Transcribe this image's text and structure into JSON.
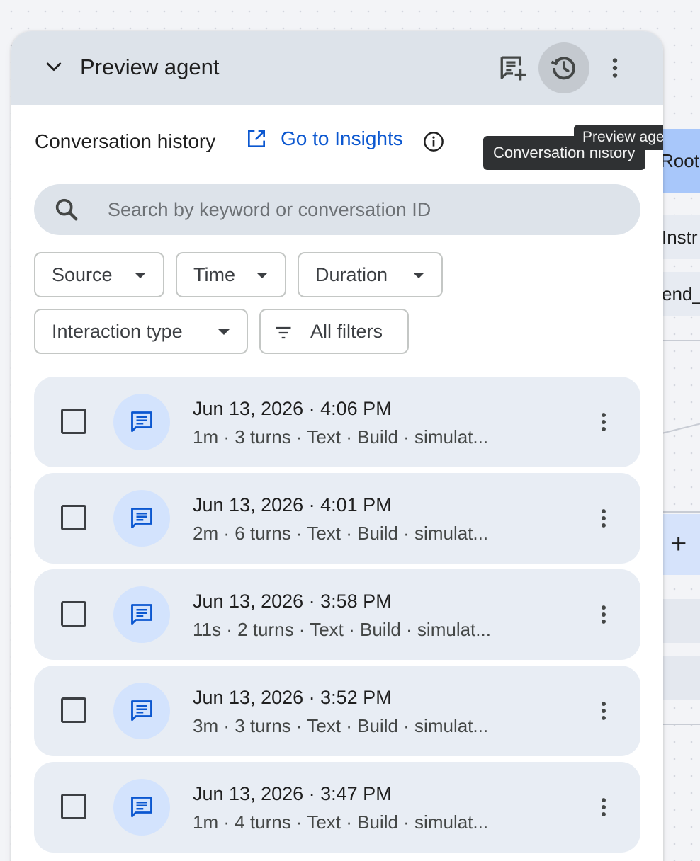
{
  "background": {
    "root_label": "Root",
    "row1_label": "Instr",
    "row2_label": "end_",
    "plus_label": "+"
  },
  "panel": {
    "title": "Preview agent",
    "tooltips": {
      "history": "Conversation history",
      "preview": "Preview agent"
    },
    "history_header": {
      "title": "Conversation history",
      "insights_link": "Go to Insights"
    },
    "search": {
      "placeholder": "Search by keyword or conversation ID",
      "value": ""
    },
    "filters": {
      "source": "Source",
      "time": "Time",
      "duration": "Duration",
      "interaction_type": "Interaction type",
      "all_filters": "All filters"
    },
    "conversations": [
      {
        "date": "Jun 13, 2026 · 4:06 PM",
        "meta": "1m · 3 turns · Text · Build · simulat..."
      },
      {
        "date": "Jun 13, 2026 · 4:01 PM",
        "meta": "2m · 6 turns · Text · Build · simulat..."
      },
      {
        "date": "Jun 13, 2026 · 3:58 PM",
        "meta": "11s · 2 turns · Text · Build · simulat..."
      },
      {
        "date": "Jun 13, 2026 · 3:52 PM",
        "meta": "3m · 3 turns · Text · Build · simulat..."
      },
      {
        "date": "Jun 13, 2026 · 3:47 PM",
        "meta": "1m · 4 turns · Text · Build · simulat..."
      }
    ]
  },
  "colors": {
    "accent": "#0b57d0",
    "header_bg": "#dde3ea",
    "card_bg": "#e8edf4",
    "avatar_bg": "#d3e3fd"
  },
  "icons": {
    "collapse": "chevron-down-icon",
    "new_chat": "new-chat-icon",
    "history": "history-icon",
    "more": "more-vert-icon",
    "external_link": "open-in-new-icon",
    "info": "info-icon",
    "close": "close-icon",
    "search": "search-icon",
    "filter": "filter-list-icon",
    "chat": "chat-icon"
  }
}
